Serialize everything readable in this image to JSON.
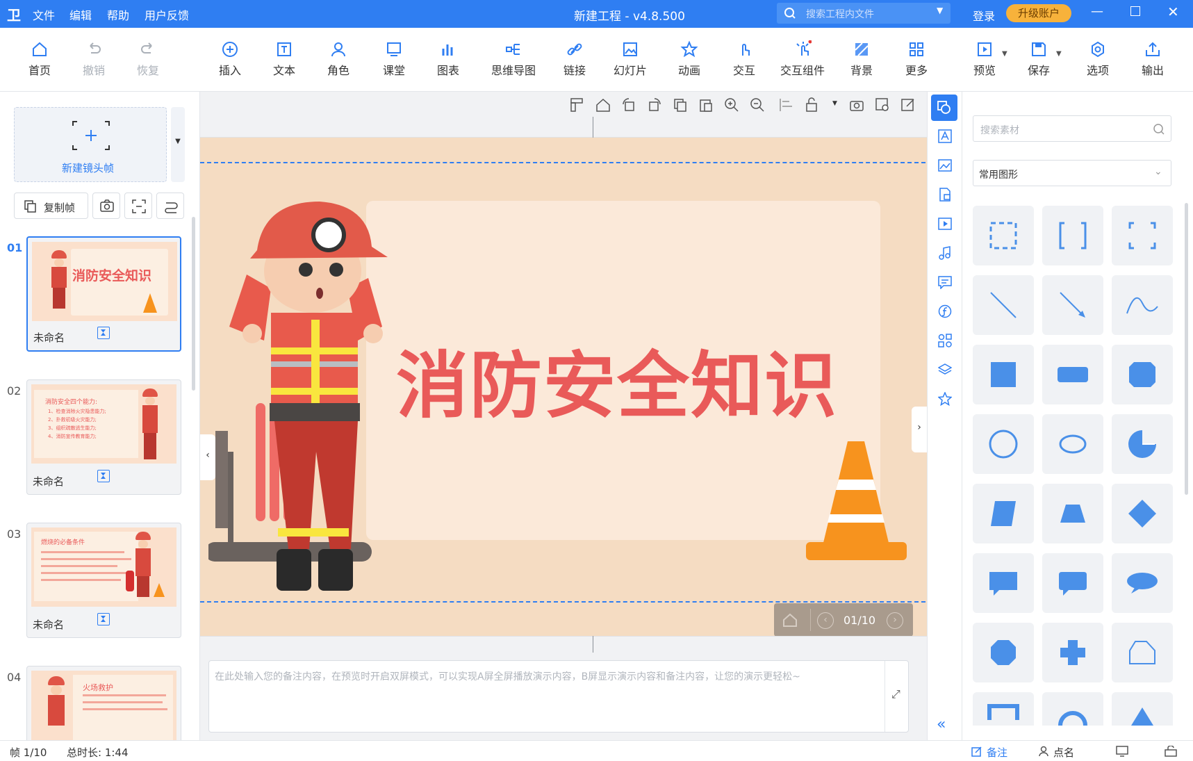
{
  "app": {
    "logo": "卫",
    "title": "新建工程 - v4.8.500",
    "search_placeholder": "搜索工程内文件",
    "login": "登录",
    "upgrade": "升级账户"
  },
  "menu": [
    "文件",
    "编辑",
    "帮助",
    "用户反馈"
  ],
  "toolbar": {
    "home": "首页",
    "undo": "撤销",
    "redo": "恢复",
    "insert": "插入",
    "text": "文本",
    "role": "角色",
    "classroom": "课堂",
    "chart": "图表",
    "mindmap": "思维导图",
    "link": "链接",
    "slides": "幻灯片",
    "animation": "动画",
    "interact": "交互",
    "widget": "交互组件",
    "background": "背景",
    "more": "更多",
    "preview": "预览",
    "save": "保存",
    "options": "选项",
    "export": "输出"
  },
  "left": {
    "new_frame": "新建镜头帧",
    "copy_frame": "复制帧",
    "frames": [
      {
        "num": "01",
        "name": "未命名"
      },
      {
        "num": "02",
        "name": "未命名"
      },
      {
        "num": "03",
        "name": "未命名"
      },
      {
        "num": "04",
        "name": ""
      }
    ]
  },
  "thumb_text": {
    "t1": "消防安全知识",
    "t2_title": "消防安全四个能力:",
    "t2_lines": [
      "1、检查消除火灾隐患能力;",
      "2、扑救初级火灾能力;",
      "3、组织疏散逃生能力;",
      "4、消防宣传教育能力;"
    ],
    "t3_title": "燃烧的必备条件",
    "t4_title": "火场救护"
  },
  "slide": {
    "title": "消防安全知识",
    "page": "01/10"
  },
  "notes": {
    "placeholder": "在此处输入您的备注内容，在预览时开启双屏模式，可以实现A屏全屏播放演示内容，B屏显示演示内容和备注内容，让您的演示更轻松~"
  },
  "right": {
    "search_placeholder": "搜索素材",
    "category": "常用图形"
  },
  "status": {
    "frame": "帧 1/10",
    "duration": "总时长: 1:44",
    "notes": "备注",
    "rollcall": "点名"
  },
  "colors": {
    "accent": "#2f7ef2",
    "title": "#e95a59",
    "shape": "#4a90e8"
  }
}
